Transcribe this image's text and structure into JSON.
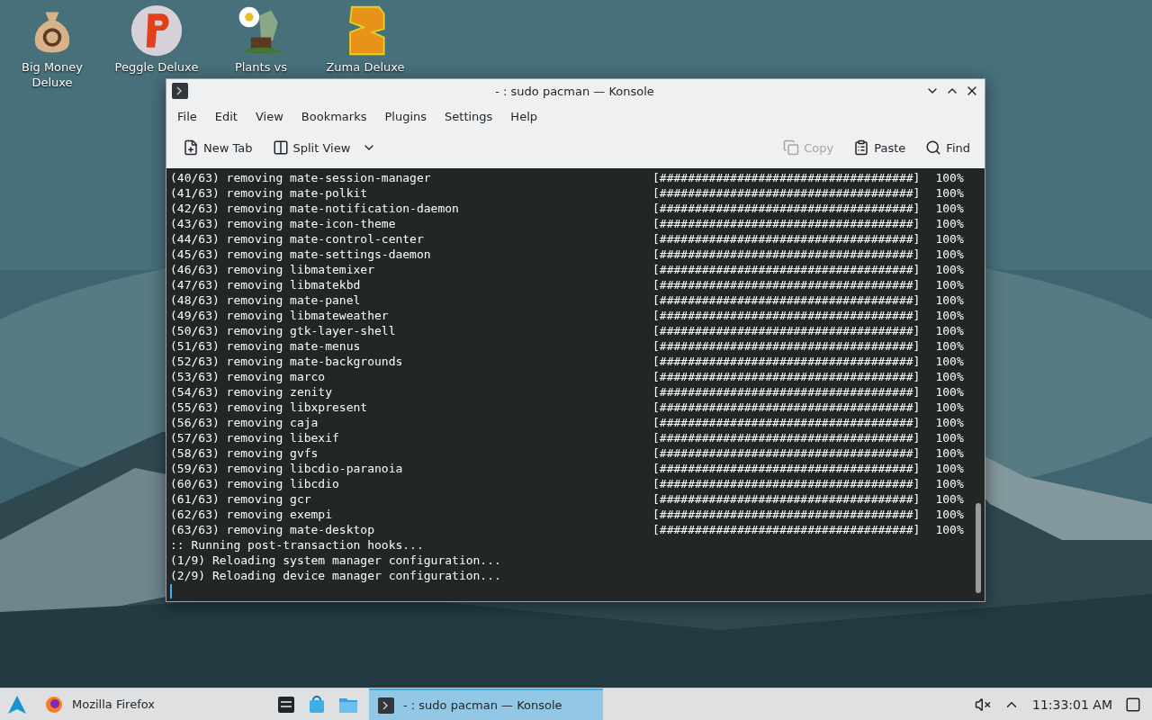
{
  "desktop_icons": [
    {
      "label": "Big Money\nDeluxe",
      "kind": "bag"
    },
    {
      "label": "Peggle Deluxe",
      "kind": "ball"
    },
    {
      "label": "Plants vs",
      "kind": "plant"
    },
    {
      "label": "Zuma Deluxe",
      "kind": "block"
    }
  ],
  "window": {
    "title": "- : sudo pacman — Konsole",
    "menu": [
      "File",
      "Edit",
      "View",
      "Bookmarks",
      "Plugins",
      "Settings",
      "Help"
    ],
    "toolbar_left": [
      {
        "label": "New Tab",
        "kind": "newtab"
      },
      {
        "label": "Split View",
        "kind": "split"
      }
    ],
    "toolbar_right": [
      {
        "label": "Copy",
        "kind": "copy",
        "disabled": true
      },
      {
        "label": "Paste",
        "kind": "paste",
        "disabled": false
      },
      {
        "label": "Find",
        "kind": "find",
        "disabled": false
      }
    ],
    "terminal": {
      "lines": [
        {
          "text": "(40/63) removing mate-session-manager",
          "bar": "[####################################]",
          "percent": "100%"
        },
        {
          "text": "(41/63) removing mate-polkit",
          "bar": "[####################################]",
          "percent": "100%"
        },
        {
          "text": "(42/63) removing mate-notification-daemon",
          "bar": "[####################################]",
          "percent": "100%"
        },
        {
          "text": "(43/63) removing mate-icon-theme",
          "bar": "[####################################]",
          "percent": "100%"
        },
        {
          "text": "(44/63) removing mate-control-center",
          "bar": "[####################################]",
          "percent": "100%"
        },
        {
          "text": "(45/63) removing mate-settings-daemon",
          "bar": "[####################################]",
          "percent": "100%"
        },
        {
          "text": "(46/63) removing libmatemixer",
          "bar": "[####################################]",
          "percent": "100%"
        },
        {
          "text": "(47/63) removing libmatekbd",
          "bar": "[####################################]",
          "percent": "100%"
        },
        {
          "text": "(48/63) removing mate-panel",
          "bar": "[####################################]",
          "percent": "100%"
        },
        {
          "text": "(49/63) removing libmateweather",
          "bar": "[####################################]",
          "percent": "100%"
        },
        {
          "text": "(50/63) removing gtk-layer-shell",
          "bar": "[####################################]",
          "percent": "100%"
        },
        {
          "text": "(51/63) removing mate-menus",
          "bar": "[####################################]",
          "percent": "100%"
        },
        {
          "text": "(52/63) removing mate-backgrounds",
          "bar": "[####################################]",
          "percent": "100%"
        },
        {
          "text": "(53/63) removing marco",
          "bar": "[####################################]",
          "percent": "100%"
        },
        {
          "text": "(54/63) removing zenity",
          "bar": "[####################################]",
          "percent": "100%"
        },
        {
          "text": "(55/63) removing libxpresent",
          "bar": "[####################################]",
          "percent": "100%"
        },
        {
          "text": "(56/63) removing caja",
          "bar": "[####################################]",
          "percent": "100%"
        },
        {
          "text": "(57/63) removing libexif",
          "bar": "[####################################]",
          "percent": "100%"
        },
        {
          "text": "(58/63) removing gvfs",
          "bar": "[####################################]",
          "percent": "100%"
        },
        {
          "text": "(59/63) removing libcdio-paranoia",
          "bar": "[####################################]",
          "percent": "100%"
        },
        {
          "text": "(60/63) removing libcdio",
          "bar": "[####################################]",
          "percent": "100%"
        },
        {
          "text": "(61/63) removing gcr",
          "bar": "[####################################]",
          "percent": "100%"
        },
        {
          "text": "(62/63) removing exempi",
          "bar": "[####################################]",
          "percent": "100%"
        },
        {
          "text": "(63/63) removing mate-desktop",
          "bar": "[####################################]",
          "percent": "100%"
        },
        {
          "text": ":: Running post-transaction hooks..."
        },
        {
          "text": "(1/9) Reloading system manager configuration..."
        },
        {
          "text": "(2/9) Reloading device manager configuration..."
        }
      ]
    }
  },
  "taskbar": {
    "tasks": [
      {
        "label": "Mozilla Firefox",
        "kind": "firefox",
        "selected": false
      },
      {
        "label": "- : sudo pacman — Konsole",
        "kind": "konsole",
        "selected": true
      }
    ],
    "launchers": [
      {
        "kind": "monitor"
      },
      {
        "kind": "store"
      },
      {
        "kind": "folder"
      }
    ],
    "clock": "11:33:01 AM"
  }
}
